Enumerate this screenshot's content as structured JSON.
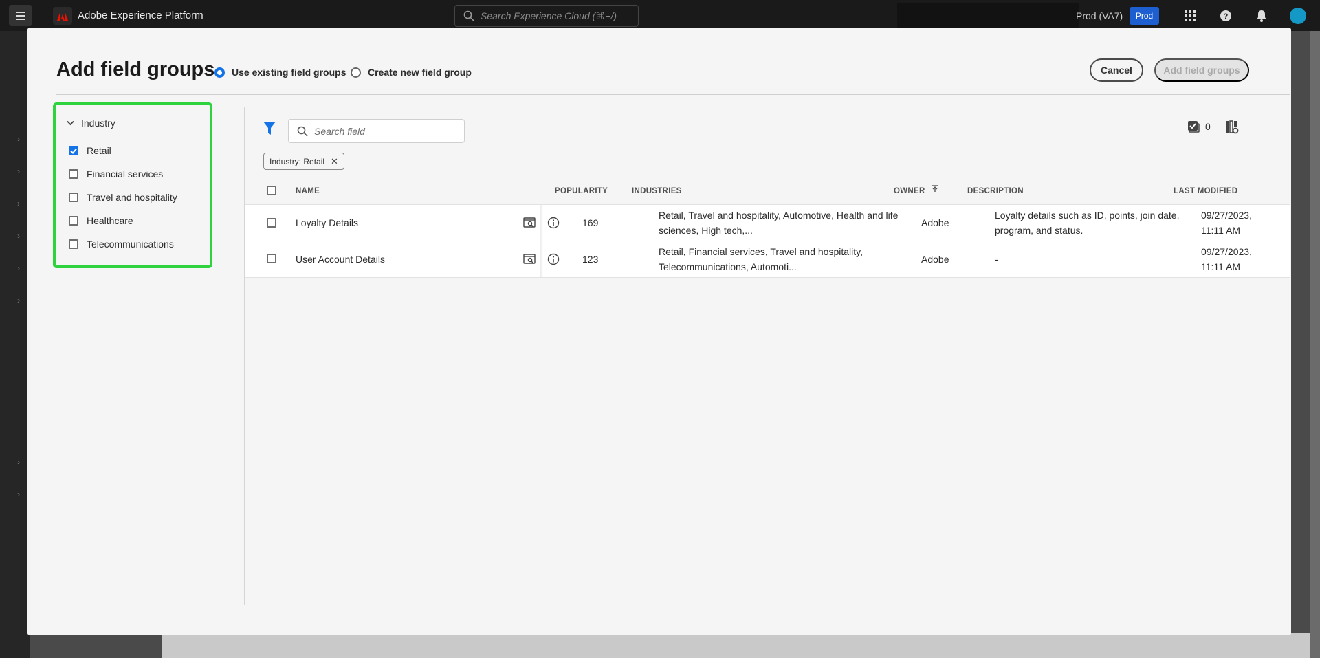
{
  "topbar": {
    "app_title": "Adobe Experience Platform",
    "search_placeholder": "Search Experience Cloud (⌘+/)",
    "sandbox_name": "Prod (VA7)",
    "environment_badge": "Prod"
  },
  "modal": {
    "title": "Add field groups",
    "mode_options": [
      {
        "label": "Use existing field groups",
        "selected": true
      },
      {
        "label": "Create new field group",
        "selected": false
      }
    ],
    "cancel_label": "Cancel",
    "add_label": "Add field groups"
  },
  "filter_panel": {
    "heading": "Industry",
    "options": [
      {
        "label": "Retail",
        "checked": true
      },
      {
        "label": "Financial services",
        "checked": false
      },
      {
        "label": "Travel and hospitality",
        "checked": false
      },
      {
        "label": "Healthcare",
        "checked": false
      },
      {
        "label": "Telecommunications",
        "checked": false
      }
    ]
  },
  "table_toolbar": {
    "search_placeholder": "Search field",
    "selected_count": "0",
    "active_filter_tag": "Industry: Retail"
  },
  "table": {
    "columns": [
      "NAME",
      "POPULARITY",
      "INDUSTRIES",
      "OWNER",
      "DESCRIPTION",
      "LAST MODIFIED"
    ],
    "rows": [
      {
        "name": "Loyalty Details",
        "popularity": "169",
        "industries": "Retail, Travel and hospitality, Automotive, Health and life sciences, High tech,...",
        "owner": "Adobe",
        "description": "Loyalty details such as ID, points, join date, program, and status.",
        "last_modified": "09/27/2023, 11:11 AM"
      },
      {
        "name": "User Account Details",
        "popularity": "123",
        "industries": "Retail, Financial services, Travel and hospitality, Telecommunications, Automoti...",
        "owner": "Adobe",
        "description": "-",
        "last_modified": "09/27/2023, 11:11 AM"
      }
    ]
  },
  "colors": {
    "accent": "#1473e6",
    "highlight_border": "#2ed33e",
    "topbar_bg": "#1a1a1a",
    "modal_bg": "#f5f5f5"
  }
}
